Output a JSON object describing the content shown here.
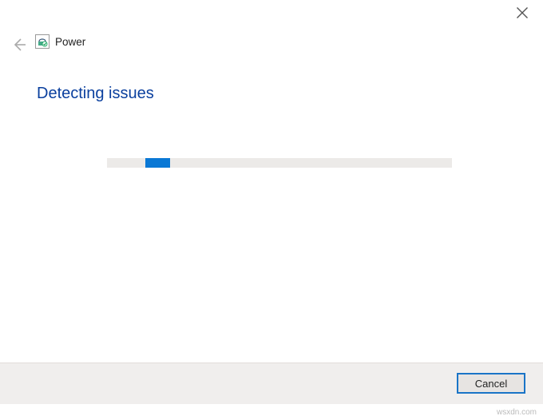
{
  "breadcrumb": {
    "title": "Power"
  },
  "heading": "Detecting issues",
  "footer": {
    "cancel_label": "Cancel"
  },
  "watermark": "wsxdn.com"
}
